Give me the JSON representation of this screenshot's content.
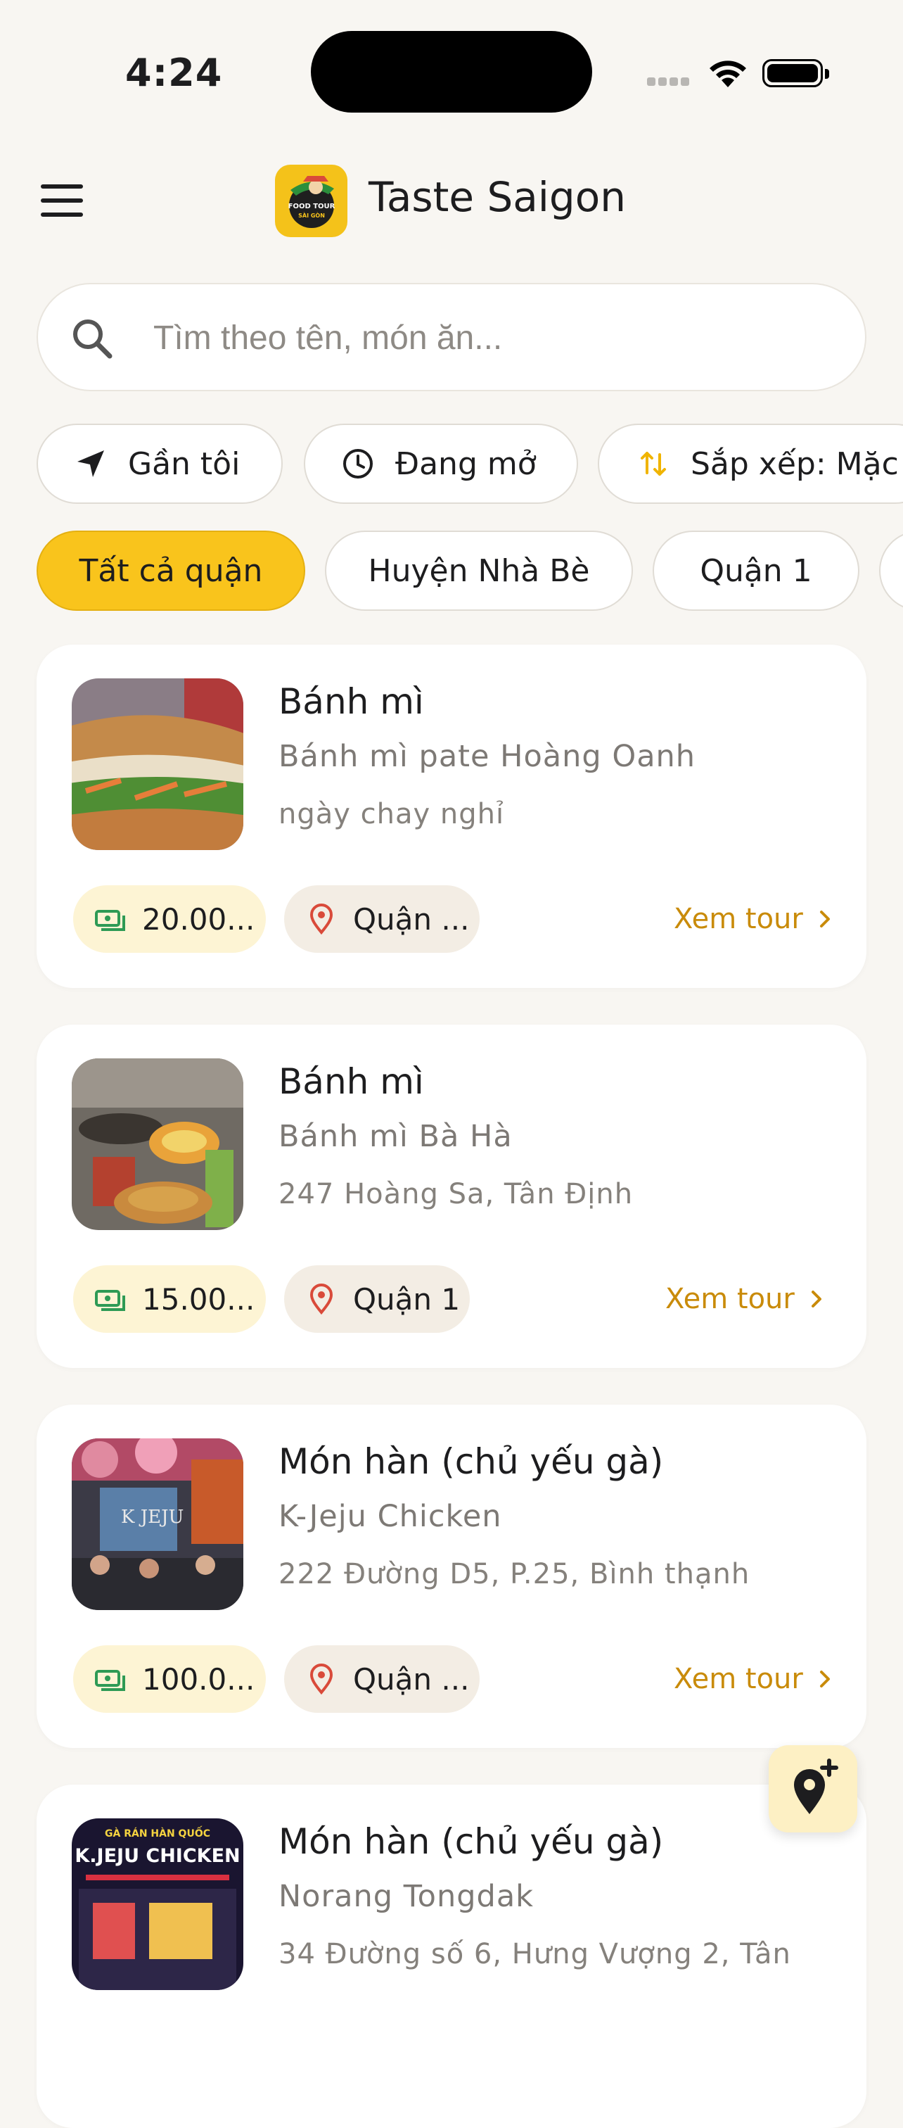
{
  "status_bar": {
    "time": "4:24"
  },
  "header": {
    "app_title": "Taste Saigon",
    "logo_text_1": "FOOD TOUR",
    "logo_text_2": "SÀI GÒN"
  },
  "search": {
    "placeholder": "Tìm theo tên, món ăn...",
    "value": ""
  },
  "filters": {
    "near_me": "Gần tôi",
    "open_now": "Đang mở",
    "sort": "Sắp xếp: Mặc định"
  },
  "districts": {
    "selected": "Tất cả quận",
    "items": [
      "Tất cả quận",
      "Huyện Nhà Bè",
      "Quận 1",
      ""
    ]
  },
  "listings": [
    {
      "dish": "Bánh mì",
      "restaurant": "Bánh mì pate Hoàng Oanh",
      "address": "ngày chay nghỉ",
      "price": "20.00...",
      "district": "Quận ...",
      "action": "Xem tour"
    },
    {
      "dish": "Bánh mì",
      "restaurant": "Bánh mì Bà Hà",
      "address": "247 Hoàng Sa, Tân Định",
      "price": "15.00...",
      "district": "Quận 1",
      "action": "Xem tour"
    },
    {
      "dish": "Món hàn (chủ yếu gà)",
      "restaurant": "K-Jeju Chicken",
      "address": "222 Đường D5, P.25, Bình thạnh",
      "price": "100.0...",
      "district": "Quận ...",
      "action": "Xem tour"
    },
    {
      "dish": "Món hàn (chủ yếu gà)",
      "restaurant": "Norang Tongdak",
      "address": "34 Đường số 6, Hưng Vượng 2, Tân",
      "price": "",
      "district": "",
      "action": ""
    }
  ],
  "thumb_signs": {
    "kjeju_banner": "K.JEJU CHICKEN",
    "kjeju_top": "GÀ RÁN HÀN QUỐC",
    "kjeju_wall": "K JEJU"
  },
  "icons": {
    "menu": "hamburger-icon",
    "search": "search-icon",
    "near_me": "navigation-arrow-icon",
    "open_now": "clock-icon",
    "sort": "sort-arrows-icon",
    "price": "banknote-icon",
    "district": "map-pin-icon",
    "chevron": "chevron-right-icon",
    "fab": "add-location-icon"
  },
  "colors": {
    "accent": "#f9c41c",
    "link": "#c98b0a",
    "price_bg": "#fdf4d4",
    "district_bg": "#f3ede4",
    "pin": "#d94a3a",
    "money": "#2e9a55"
  }
}
